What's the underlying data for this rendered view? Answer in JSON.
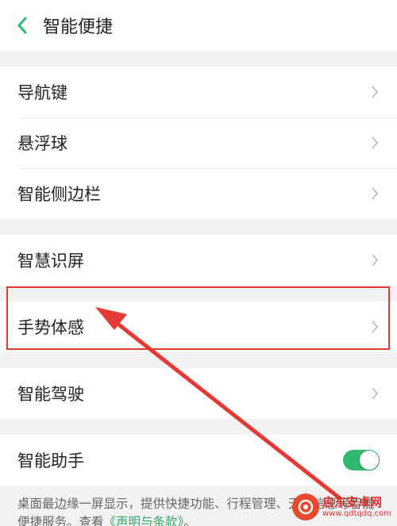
{
  "header": {
    "title": "智能便捷",
    "back_icon": "chevron-left-icon",
    "accent": "#33b86f"
  },
  "groups": [
    {
      "items": [
        {
          "label": "导航键"
        },
        {
          "label": "悬浮球"
        },
        {
          "label": "智能侧边栏"
        }
      ]
    },
    {
      "items": [
        {
          "label": "智慧识屏"
        }
      ]
    },
    {
      "items": [
        {
          "label": "手势体感"
        }
      ]
    },
    {
      "items": [
        {
          "label": "智能驾驶"
        }
      ]
    }
  ],
  "assistant": {
    "label": "智能助手",
    "toggle_on": true,
    "desc_prefix": "桌面最边缘一屏显示，提供快捷功能、行程管理、天气信息等智能便捷服务。查看",
    "desc_link": "《声明与条款》",
    "desc_suffix": "。"
  },
  "annotation": {
    "highlight_color": "#e53935"
  },
  "watermark": {
    "name": "启东安卓网",
    "url": "www.qdtqdq.com"
  }
}
